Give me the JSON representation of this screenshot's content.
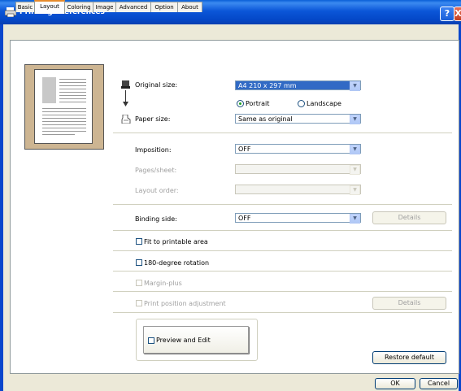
{
  "window": {
    "title": "Printing Preferences",
    "help_label": "?",
    "close_label": "X"
  },
  "tabs": [
    "Basic",
    "Layout",
    "Coloring",
    "Image",
    "Advanced",
    "Option",
    "About"
  ],
  "active_tab": "Layout",
  "original_size": {
    "label": "Original size:",
    "value": "A4 210 x 297 mm"
  },
  "orientation": {
    "portrait_label": "Portrait",
    "landscape_label": "Landscape",
    "selected": "Portrait"
  },
  "paper_size": {
    "label": "Paper size:",
    "value": "Same as original"
  },
  "imposition": {
    "label": "Imposition:",
    "value": "OFF"
  },
  "pages_sheet": {
    "label": "Pages/sheet:",
    "value": ""
  },
  "layout_order": {
    "label": "Layout order:",
    "value": ""
  },
  "binding_side": {
    "label": "Binding side:",
    "value": "OFF",
    "details_label": "Details"
  },
  "fit_to_printable": {
    "label": "Fit to printable area",
    "checked": false
  },
  "rotation": {
    "label": "180-degree rotation",
    "checked": false
  },
  "margin_plus": {
    "label": "Margin-plus",
    "checked": false
  },
  "print_position": {
    "label": "Print position adjustment",
    "checked": false,
    "details_label": "Details"
  },
  "preview_edit": {
    "label": "Preview and Edit",
    "checked": false
  },
  "restore_default_label": "Restore default",
  "ok_label": "OK",
  "cancel_label": "Cancel",
  "colors": {
    "title_bar": "#0b56d8",
    "selection": "#316ac5",
    "tab_highlight": "#e68b2c",
    "thumbnail_bg": "#cdb592"
  },
  "icons": [
    "printer-icon",
    "down-arrow-icon",
    "paper-icon",
    "dropdown-arrow-icon"
  ]
}
